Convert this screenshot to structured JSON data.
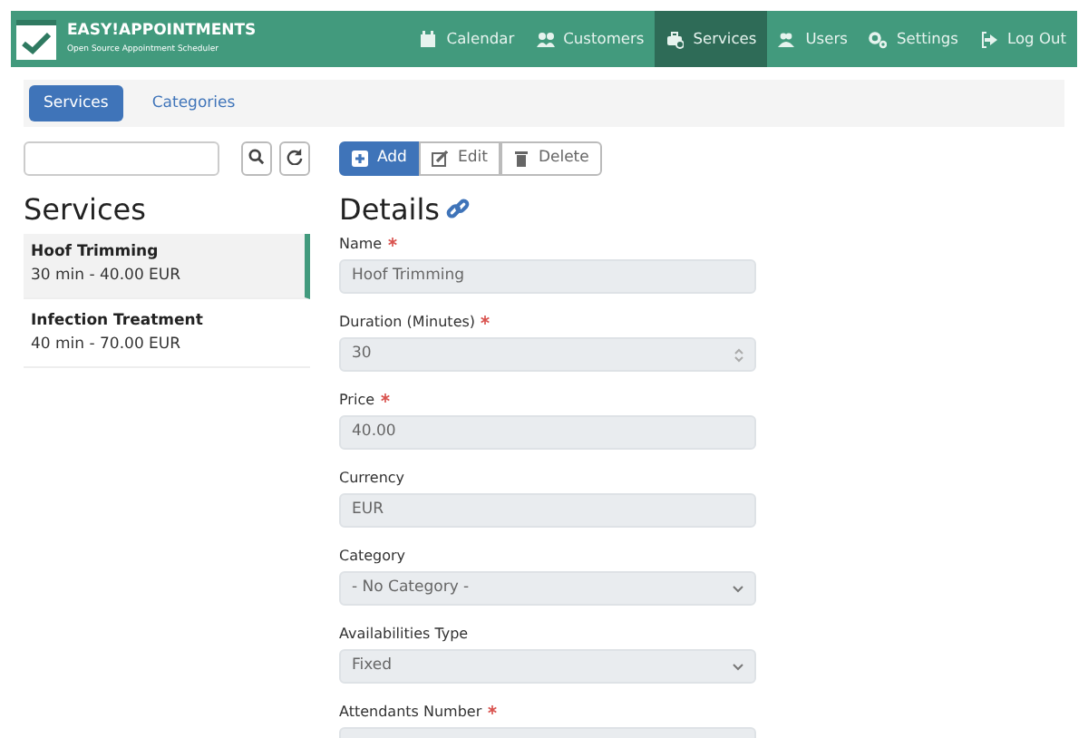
{
  "brand": {
    "title": "EASY!APPOINTMENTS",
    "subtitle": "Open Source Appointment Scheduler"
  },
  "nav": [
    {
      "label": "Calendar",
      "selected": false
    },
    {
      "label": "Customers",
      "selected": false
    },
    {
      "label": "Services",
      "selected": true
    },
    {
      "label": "Users",
      "selected": false
    },
    {
      "label": "Settings",
      "selected": false
    },
    {
      "label": "Log Out",
      "selected": false
    }
  ],
  "tabs": [
    {
      "label": "Services",
      "selected": true
    },
    {
      "label": "Categories",
      "selected": false
    }
  ],
  "toolbar": [
    {
      "label": "Add",
      "primary": true
    },
    {
      "label": "Edit",
      "primary": false
    },
    {
      "label": "Delete",
      "primary": false
    }
  ],
  "list_title": "Services",
  "services": [
    {
      "name": "Hoof Trimming",
      "details": "30 min - 40.00 EUR",
      "selected": true
    },
    {
      "name": "Infection Treatment",
      "details": "40 min - 70.00 EUR",
      "selected": false
    }
  ],
  "details_title": "Details",
  "fields": [
    {
      "label": "Name",
      "required": true,
      "kind": "input",
      "value": "Hoof Trimming"
    },
    {
      "label": "Duration (Minutes)",
      "required": true,
      "kind": "number",
      "value": "30"
    },
    {
      "label": "Price",
      "required": true,
      "kind": "input",
      "value": "40.00"
    },
    {
      "label": "Currency",
      "required": false,
      "kind": "input",
      "value": "EUR"
    },
    {
      "label": "Category",
      "required": false,
      "kind": "select",
      "value": "- No Category -"
    },
    {
      "label": "Availabilities Type",
      "required": false,
      "kind": "select",
      "value": "Fixed"
    },
    {
      "label": "Attendants Number",
      "required": true,
      "kind": "input"
    }
  ]
}
